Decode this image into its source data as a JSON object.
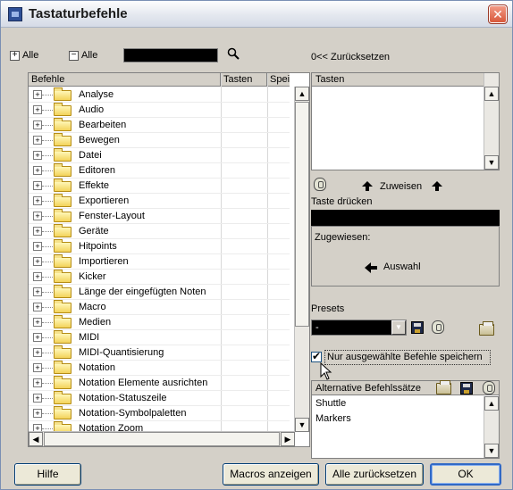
{
  "window": {
    "title": "Tastaturbefehle",
    "close": "✕"
  },
  "toolbar": {
    "expand_all": "Alle",
    "collapse_all": "Alle",
    "search_value": "",
    "reset_label": "0<< Zurücksetzen"
  },
  "commands": {
    "columns": [
      "Befehle",
      "Tasten",
      "Speich"
    ],
    "items": [
      "Analyse",
      "Audio",
      "Bearbeiten",
      "Bewegen",
      "Datei",
      "Editoren",
      "Effekte",
      "Exportieren",
      "Fenster-Layout",
      "Geräte",
      "Hitpoints",
      "Importieren",
      "Kicker",
      "Länge der eingefügten Noten",
      "Macro",
      "Medien",
      "MIDI",
      "MIDI-Quantisierung",
      "Notation",
      "Notation Elemente ausrichten",
      "Notation-Statuszeile",
      "Notation-Symbolpaletten",
      "Notation Zoom"
    ]
  },
  "keys": {
    "header": "Tasten",
    "assign_label": "Zuweisen",
    "press_label": "Taste drücken",
    "assigned_label": "Zugewiesen:",
    "select_label": "Auswahl"
  },
  "presets": {
    "label": "Presets",
    "selected": "-"
  },
  "save_selected": {
    "label": "Nur ausgewählte Befehle speichern",
    "checked": true
  },
  "alt_sets": {
    "header": "Alternative Befehlssätze",
    "items": [
      "Shuttle",
      "Markers"
    ]
  },
  "buttons": {
    "help": "Hilfe",
    "show_macros": "Macros anzeigen",
    "reset_all": "Alle zurücksetzen",
    "ok": "OK"
  },
  "colors": {
    "window_bg": "#d4d0c8",
    "field_black": "#000000",
    "close_red": "#d8583b",
    "default_button_border": "#3169c6"
  }
}
